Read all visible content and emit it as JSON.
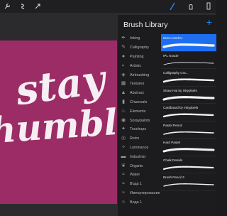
{
  "panel": {
    "title": "Brush Library",
    "add_label": "+"
  },
  "art": {
    "line1": "stay",
    "line2": "humble"
  },
  "categories": [
    {
      "label": "Inking",
      "icon": "ink-drop-icon"
    },
    {
      "label": "Calligraphy",
      "icon": "pen-icon"
    },
    {
      "label": "Painting",
      "icon": "drop-icon"
    },
    {
      "label": "Artistic",
      "icon": "palette-icon"
    },
    {
      "label": "Airbrushing",
      "icon": "airbrush-icon"
    },
    {
      "label": "Textures",
      "icon": "grid-icon"
    },
    {
      "label": "Abstract",
      "icon": "triangle-icon"
    },
    {
      "label": "Charcoals",
      "icon": "charcoal-icon"
    },
    {
      "label": "Elements",
      "icon": "flame-icon"
    },
    {
      "label": "Spraypaints",
      "icon": "spray-icon"
    },
    {
      "label": "Touchups",
      "icon": "touchup-icon"
    },
    {
      "label": "Retro",
      "icon": "retro-icon"
    },
    {
      "label": "Luminance",
      "icon": "sparkle-icon"
    },
    {
      "label": "Industrial",
      "icon": "anvil-icon"
    },
    {
      "label": "Organic",
      "icon": "leaf-icon"
    },
    {
      "label": "Water",
      "icon": "wave-icon"
    },
    {
      "label": "Вода 1",
      "icon": "wave-icon"
    },
    {
      "label": "Импортирование",
      "icon": "wave-icon"
    },
    {
      "label": "Вода 1",
      "icon": "wave-icon"
    }
  ],
  "brushes": [
    {
      "name": "Bistro Marker",
      "selected": true
    },
    {
      "name": "IPL Gracie",
      "selected": false
    },
    {
      "name": "Calligraphy Cra...",
      "selected": false
    },
    {
      "name": "Straw Hat by Inkyplxels",
      "selected": false
    },
    {
      "name": "Cardboard by Inkyplxels",
      "selected": false
    },
    {
      "name": "Pastel Pencil",
      "selected": false
    },
    {
      "name": "Hard Pastel",
      "selected": false
    },
    {
      "name": "Chalk Details",
      "selected": false
    },
    {
      "name": "Brush Pencil 3",
      "selected": false
    }
  ],
  "colors": {
    "accent": "#1e8bff",
    "canvas_pink": "#9c2c66",
    "selected_row": "#1e6ff0"
  }
}
